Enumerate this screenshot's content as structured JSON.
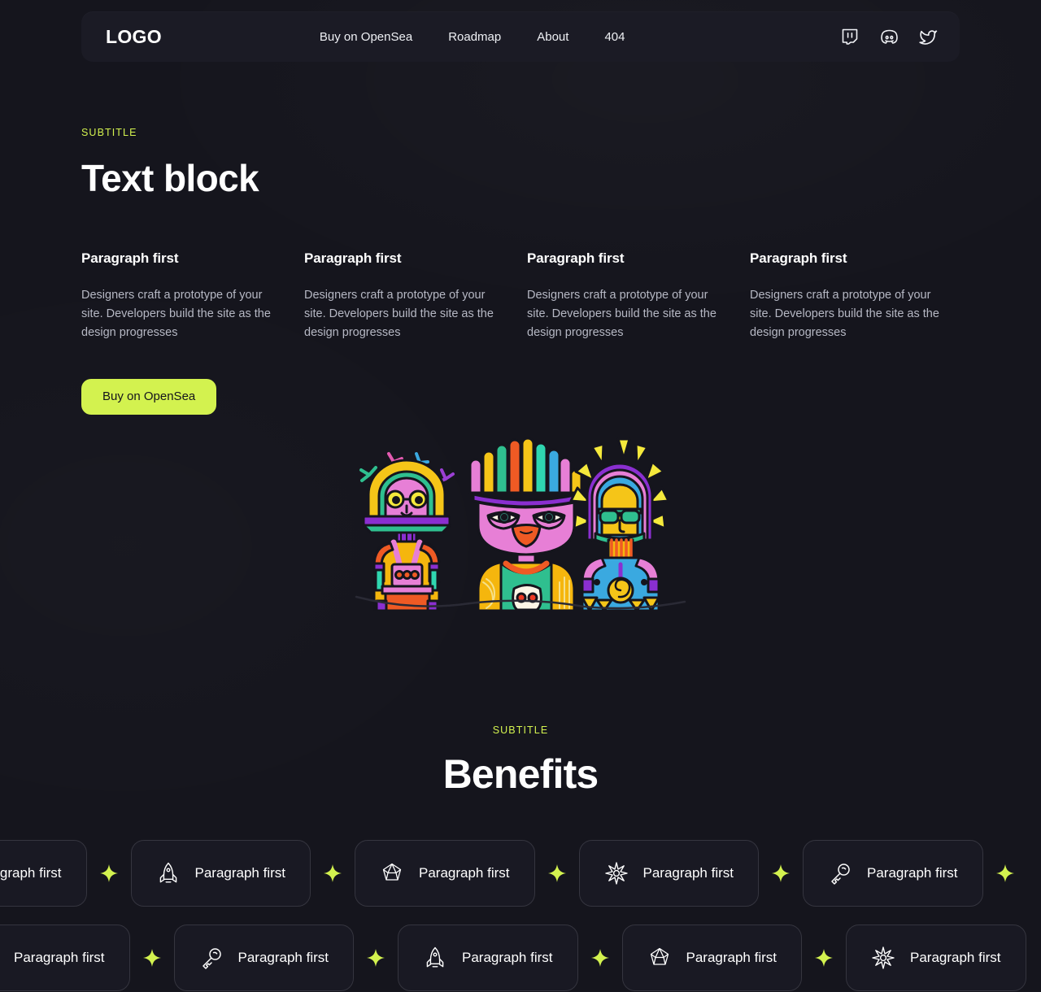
{
  "header": {
    "logo": "LOGO",
    "nav": [
      {
        "label": "Buy on OpenSea",
        "name": "nav-link-buy-on-opensea"
      },
      {
        "label": "Roadmap",
        "name": "nav-link-roadmap"
      },
      {
        "label": "About",
        "name": "nav-link-about"
      },
      {
        "label": "404",
        "name": "nav-link-404"
      }
    ],
    "socials": [
      {
        "icon": "twitch-icon",
        "label": "Twitch"
      },
      {
        "icon": "discord-icon",
        "label": "Discord"
      },
      {
        "icon": "twitter-icon",
        "label": "Twitter"
      }
    ]
  },
  "text_block": {
    "eyebrow": "SUBTITLE",
    "title": "Text block",
    "columns": [
      {
        "title": "Paragraph first",
        "body": "Designers craft a prototype of your site. Developers build the site as the design progresses"
      },
      {
        "title": "Paragraph first",
        "body": "Designers craft a prototype of your site. Developers build the site as the design progresses"
      },
      {
        "title": "Paragraph first",
        "body": "Designers craft a prototype of your site. Developers build the site as the design progresses"
      },
      {
        "title": "Paragraph first",
        "body": "Designers craft a prototype of your site. Developers build the site as the design progresses"
      }
    ],
    "cta": "Buy on OpenSea"
  },
  "illustration": {
    "alt": "Three colorful NFT characters",
    "characters": [
      "astronaut-character",
      "feathered-character",
      "sunburst-character"
    ]
  },
  "benefits": {
    "eyebrow": "SUBTITLE",
    "title": "Benefits",
    "row1": [
      {
        "icon": "gem-icon",
        "label": "Paragraph first"
      },
      {
        "icon": "rocket-icon",
        "label": "Paragraph first"
      },
      {
        "icon": "gem-icon",
        "label": "Paragraph first"
      },
      {
        "icon": "starburst-icon",
        "label": "Paragraph first"
      },
      {
        "icon": "key-icon",
        "label": "Paragraph first"
      }
    ],
    "row2": [
      {
        "icon": "spiral-icon",
        "label": "Paragraph first"
      },
      {
        "icon": "key-icon",
        "label": "Paragraph first"
      },
      {
        "icon": "rocket-icon",
        "label": "Paragraph first"
      },
      {
        "icon": "gem-icon",
        "label": "Paragraph first"
      },
      {
        "icon": "starburst-icon",
        "label": "Paragraph first"
      }
    ],
    "separator_icon": "sparkle-icon"
  },
  "colors": {
    "accent": "#d3f24f",
    "background": "#15151d",
    "card": "#191923",
    "navbar": "#1b1b25",
    "border": "#35353f",
    "text": "#ffffff",
    "muted": "#b6b8c4"
  }
}
